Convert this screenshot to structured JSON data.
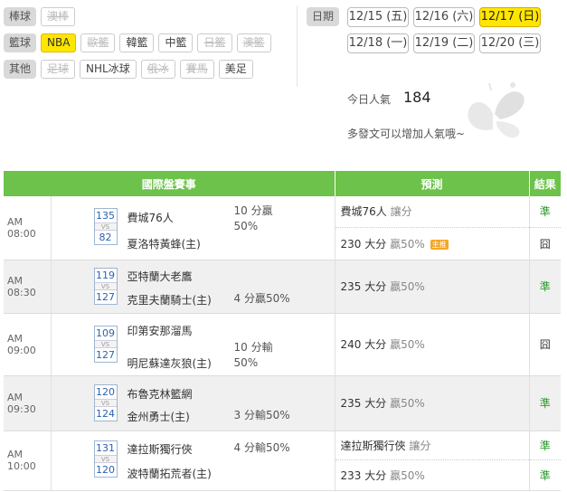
{
  "categories": [
    {
      "label": "棒球",
      "tags": [
        {
          "name": "澳棒",
          "state": "disabled"
        }
      ]
    },
    {
      "label": "籃球",
      "tags": [
        {
          "name": "NBA",
          "state": "active"
        },
        {
          "name": "歐籃",
          "state": "disabled"
        },
        {
          "name": "韓籃",
          "state": "normal"
        },
        {
          "name": "中籃",
          "state": "normal"
        },
        {
          "name": "日籃",
          "state": "disabled"
        },
        {
          "name": "澳籃",
          "state": "disabled"
        }
      ]
    },
    {
      "label": "其他",
      "tags": [
        {
          "name": "足球",
          "state": "disabled"
        },
        {
          "name": "NHL冰球",
          "state": "normal"
        },
        {
          "name": "俄冰",
          "state": "disabled"
        },
        {
          "name": "賽馬",
          "state": "disabled"
        },
        {
          "name": "美足",
          "state": "normal"
        }
      ]
    }
  ],
  "dates": {
    "label": "日期",
    "row1": [
      {
        "text": "12/15 (五)",
        "active": false
      },
      {
        "text": "12/16 (六)",
        "active": false
      },
      {
        "text": "12/17 (日)",
        "active": true
      }
    ],
    "row2": [
      {
        "text": "12/18 (一)",
        "active": false
      },
      {
        "text": "12/19 (二)",
        "active": false
      },
      {
        "text": "12/20 (三)",
        "active": false
      }
    ]
  },
  "popularity": {
    "label": "今日人氣",
    "value": "184",
    "note": "多發文可以增加人氣哦~"
  },
  "table": {
    "headers": {
      "match": "國際盤賽事",
      "predict": "預測",
      "result": "結果"
    },
    "games": [
      {
        "time": "AM 08:00",
        "score_away": "135",
        "score_home": "82",
        "vs": "VS",
        "away": "費城76人",
        "home": "夏洛特黃蜂(主)",
        "odds_top": "10 分贏",
        "odds_sub": "50%",
        "odds_bottom": "",
        "pred1": "費城76人",
        "pred1_tail": "讓分",
        "pred2": "230 大分",
        "pred2_tail": "贏50%",
        "pred2_badge": "主推",
        "res1": "準",
        "res2": "囧"
      },
      {
        "time": "AM 08:30",
        "score_away": "119",
        "score_home": "127",
        "vs": "VS",
        "away": "亞特蘭大老鷹",
        "home": "克里夫蘭騎士(主)",
        "odds_top": "",
        "odds_sub": "",
        "odds_bottom": "4 分贏50%",
        "pred1": "235 大分",
        "pred1_tail": "贏50%",
        "pred2": "",
        "pred2_tail": "",
        "pred2_badge": "",
        "res1": "準",
        "res2": ""
      },
      {
        "time": "AM 09:00",
        "score_away": "109",
        "score_home": "127",
        "vs": "VS",
        "away": "印第安那溜馬",
        "home": "明尼蘇達灰狼(主)",
        "odds_top": "10 分輸",
        "odds_sub": "50%",
        "odds_bottom": "",
        "pred1": "240 大分",
        "pred1_tail": "贏50%",
        "pred2": "",
        "pred2_tail": "",
        "pred2_badge": "",
        "res1": "囧",
        "res2": ""
      },
      {
        "time": "AM 09:30",
        "score_away": "120",
        "score_home": "124",
        "vs": "VS",
        "away": "布魯克林籃網",
        "home": "金州勇士(主)",
        "odds_top": "",
        "odds_sub": "",
        "odds_bottom": "3 分輸50%",
        "pred1": "235 大分",
        "pred1_tail": "贏50%",
        "pred2": "",
        "pred2_tail": "",
        "pred2_badge": "",
        "res1": "準",
        "res2": ""
      },
      {
        "time": "AM 10:00",
        "score_away": "131",
        "score_home": "120",
        "vs": "VS",
        "away": "達拉斯獨行俠",
        "home": "波特蘭拓荒者(主)",
        "odds_top": "4 分輸50%",
        "odds_sub": "",
        "odds_bottom": "",
        "pred1": "達拉斯獨行俠",
        "pred1_tail": "讓分",
        "pred2": "233 大分",
        "pred2_tail": "贏50%",
        "pred2_badge": "",
        "res1": "準",
        "res2": "準"
      }
    ]
  }
}
